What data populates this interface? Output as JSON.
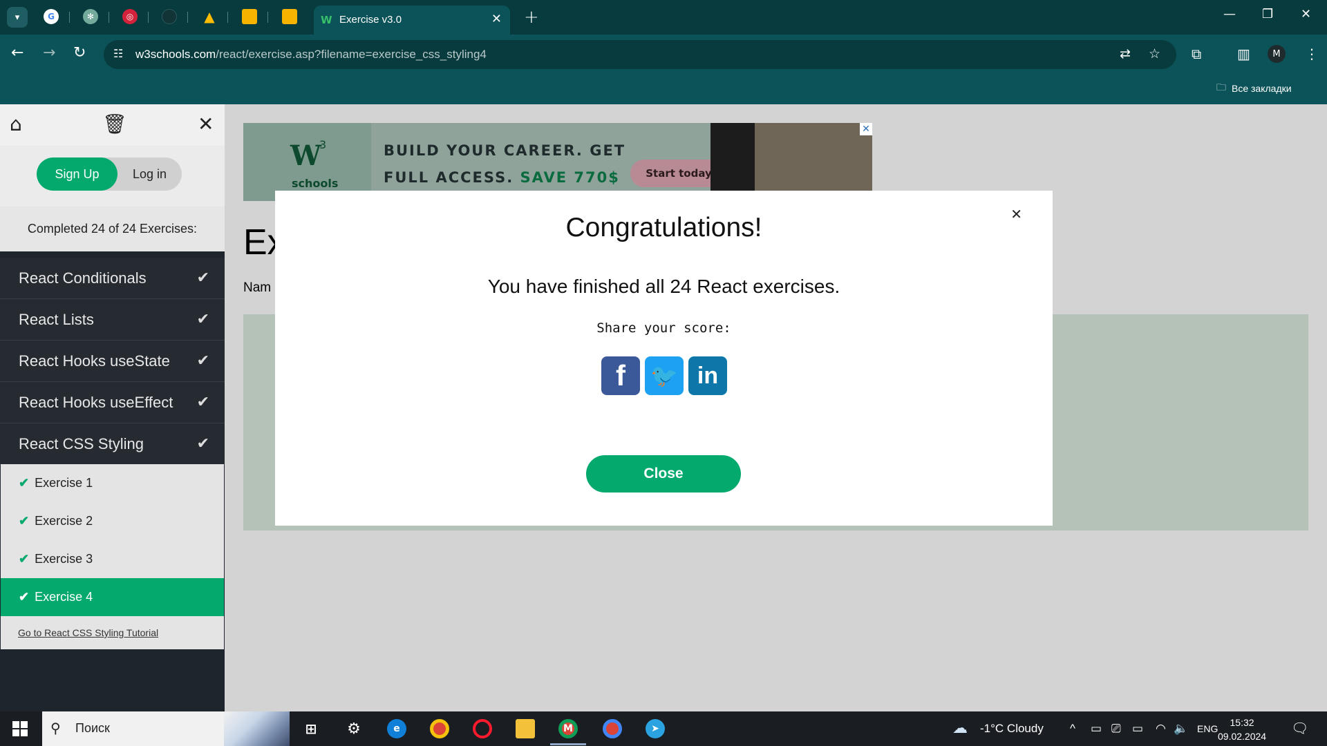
{
  "browser": {
    "active_tab_title": "Exercise v3.0",
    "url_host": "w3schools.com",
    "url_path": "/react/exercise.asp?filename=exercise_css_styling4",
    "bookmarks_label": "Все закладки",
    "profile_initial": "M"
  },
  "sidebar": {
    "auth": {
      "signup": "Sign Up",
      "login": "Log in"
    },
    "completed": "Completed 24 of 24 Exercises:",
    "topics": [
      {
        "label": "React Conditionals"
      },
      {
        "label": "React Lists"
      },
      {
        "label": "React Hooks useState"
      },
      {
        "label": "React Hooks useEffect"
      },
      {
        "label": "React CSS Styling"
      }
    ],
    "exercises": [
      {
        "label": "Exercise 1"
      },
      {
        "label": "Exercise 2"
      },
      {
        "label": "Exercise 3"
      },
      {
        "label": "Exercise 4"
      }
    ],
    "tutorial_link": "Go to React CSS Styling Tutorial"
  },
  "ad": {
    "brand_w": "W",
    "brand_sup": "3",
    "brand_sub": "schools",
    "line1": "BUILD YOUR CAREER. GET",
    "line2_prefix": "FULL ACCESS.",
    "line2_save": "SAVE 770$",
    "cta": "Start today"
  },
  "content": {
    "heading_partial": "Ex",
    "name_partial": "Nam"
  },
  "modal": {
    "title": "Congratulations!",
    "message": "You have finished all 24 React exercises.",
    "share_label": "Share your score:",
    "close_button": "Close"
  },
  "taskbar": {
    "search_placeholder": "Поиск",
    "weather": "-1°C  Cloudy",
    "language": "ENG",
    "time": "15:32",
    "date": "09.02.2024"
  },
  "colors": {
    "w3_green": "#04aa6d",
    "chrome_dark": "#073b3e",
    "chrome_teal": "#0b5358",
    "sidebar_dark": "#1f252c"
  }
}
